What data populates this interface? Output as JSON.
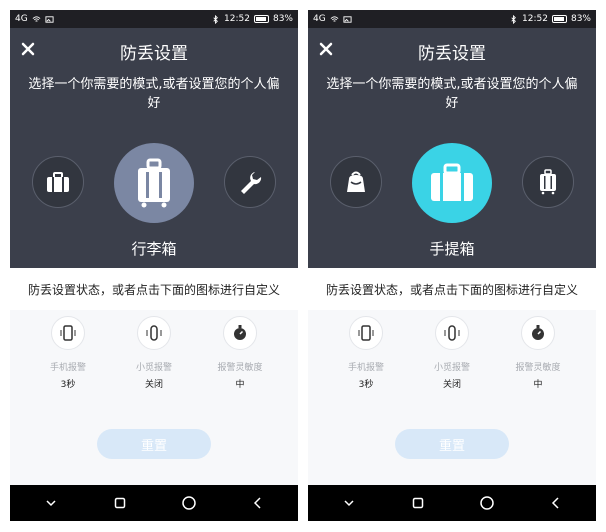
{
  "screens": [
    {
      "status": {
        "signal": "4G",
        "time": "12:52",
        "battery": "83%"
      },
      "title": "防丢设置",
      "subtitle": "选择一个你需要的模式,或者设置您的个人偏好",
      "modes": {
        "left_icon": "briefcase-icon",
        "center_icon": "luggage-icon",
        "right_icon": "wrench-icon",
        "selected_label": "行李箱"
      },
      "hint": "防丢设置状态，或者点击下面的图标进行自定义",
      "settings": [
        {
          "label": "手机报警",
          "value": "3秒",
          "icon": "phone-vibrate-icon"
        },
        {
          "label": "小觅报警",
          "value": "关闭",
          "icon": "band-vibrate-icon"
        },
        {
          "label": "报警灵敏度",
          "value": "中",
          "icon": "sensitivity-dial-icon"
        }
      ],
      "reset_label": "重置"
    },
    {
      "status": {
        "signal": "4G",
        "time": "12:52",
        "battery": "83%"
      },
      "title": "防丢设置",
      "subtitle": "选择一个你需要的模式,或者设置您的个人偏好",
      "modes": {
        "left_icon": "backpack-icon",
        "center_icon": "handbag-icon",
        "right_icon": "luggage-icon",
        "selected_label": "手提箱"
      },
      "hint": "防丢设置状态，或者点击下面的图标进行自定义",
      "settings": [
        {
          "label": "手机报警",
          "value": "3秒",
          "icon": "phone-vibrate-icon"
        },
        {
          "label": "小觅报警",
          "value": "关闭",
          "icon": "band-vibrate-icon"
        },
        {
          "label": "报警灵敏度",
          "value": "中",
          "icon": "sensitivity-dial-icon"
        }
      ],
      "reset_label": "重置"
    }
  ],
  "colors": {
    "panel": "#3b3f4b",
    "selected_left": "#7b87a3",
    "selected_right": "#3ad3e6",
    "reset_button": "#d8e8f8"
  }
}
